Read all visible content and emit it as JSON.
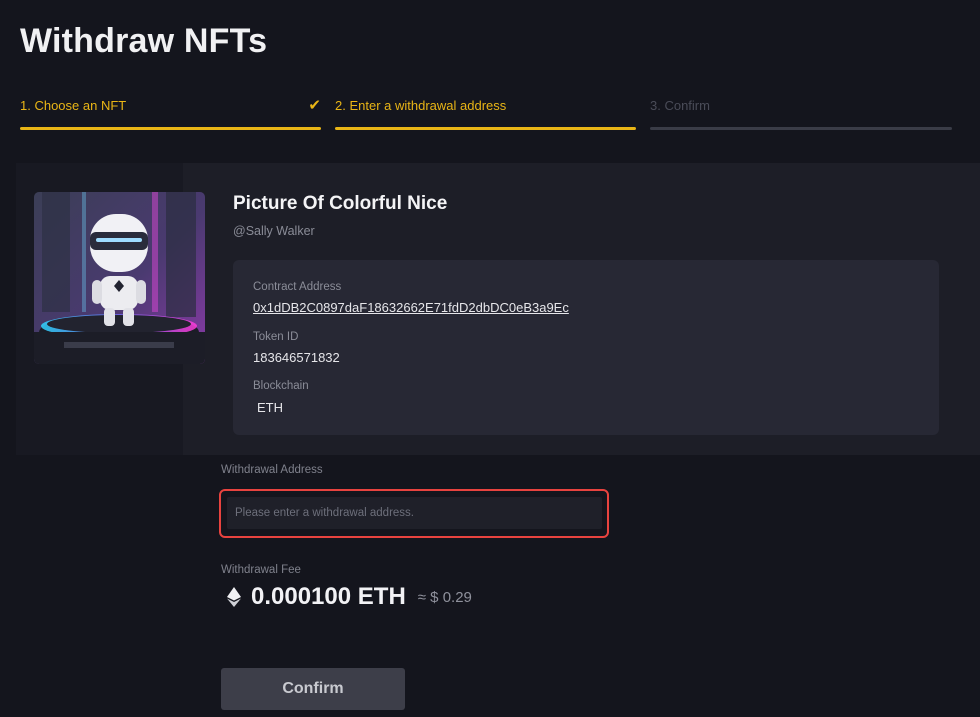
{
  "page": {
    "title": "Withdraw NFTs"
  },
  "steps": [
    {
      "label": "1. Choose an NFT",
      "state": "done"
    },
    {
      "label": "2. Enter a withdrawal address",
      "state": "active"
    },
    {
      "label": "3. Confirm",
      "state": "pending"
    }
  ],
  "nft": {
    "name": "Picture Of Colorful Nice",
    "owner": "@Sally Walker",
    "contract_label": "Contract Address",
    "contract_value": "0x1dDB2C0897daF18632662E71fdD2dbDC0eB3a9Ec",
    "token_label": "Token ID",
    "token_value": "183646571832",
    "chain_label": "Blockchain",
    "chain_value": "ETH"
  },
  "withdrawal": {
    "address_label": "Withdrawal Address",
    "address_placeholder": "Please enter a withdrawal address.",
    "address_value": "",
    "fee_label": "Withdrawal Fee",
    "fee_amount": "0.000100 ETH",
    "fee_approx": "≈ $ 0.29"
  },
  "actions": {
    "confirm_label": "Confirm"
  },
  "colors": {
    "accent": "#e9b516",
    "highlight": "#e8433f",
    "background": "#14151d"
  },
  "icons": {
    "step_done": "check-icon",
    "currency": "ethereum-icon"
  }
}
